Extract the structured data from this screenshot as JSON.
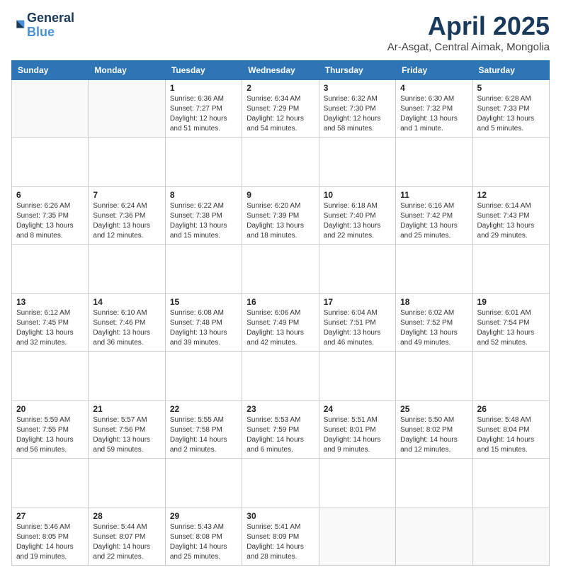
{
  "header": {
    "logo_general": "General",
    "logo_blue": "Blue",
    "month_title": "April 2025",
    "location": "Ar-Asgat, Central Aimak, Mongolia"
  },
  "days_of_week": [
    "Sunday",
    "Monday",
    "Tuesday",
    "Wednesday",
    "Thursday",
    "Friday",
    "Saturday"
  ],
  "weeks": [
    [
      {
        "day": "",
        "info": ""
      },
      {
        "day": "",
        "info": ""
      },
      {
        "day": "1",
        "info": "Sunrise: 6:36 AM\nSunset: 7:27 PM\nDaylight: 12 hours and 51 minutes."
      },
      {
        "day": "2",
        "info": "Sunrise: 6:34 AM\nSunset: 7:29 PM\nDaylight: 12 hours and 54 minutes."
      },
      {
        "day": "3",
        "info": "Sunrise: 6:32 AM\nSunset: 7:30 PM\nDaylight: 12 hours and 58 minutes."
      },
      {
        "day": "4",
        "info": "Sunrise: 6:30 AM\nSunset: 7:32 PM\nDaylight: 13 hours and 1 minute."
      },
      {
        "day": "5",
        "info": "Sunrise: 6:28 AM\nSunset: 7:33 PM\nDaylight: 13 hours and 5 minutes."
      }
    ],
    [
      {
        "day": "6",
        "info": "Sunrise: 6:26 AM\nSunset: 7:35 PM\nDaylight: 13 hours and 8 minutes."
      },
      {
        "day": "7",
        "info": "Sunrise: 6:24 AM\nSunset: 7:36 PM\nDaylight: 13 hours and 12 minutes."
      },
      {
        "day": "8",
        "info": "Sunrise: 6:22 AM\nSunset: 7:38 PM\nDaylight: 13 hours and 15 minutes."
      },
      {
        "day": "9",
        "info": "Sunrise: 6:20 AM\nSunset: 7:39 PM\nDaylight: 13 hours and 18 minutes."
      },
      {
        "day": "10",
        "info": "Sunrise: 6:18 AM\nSunset: 7:40 PM\nDaylight: 13 hours and 22 minutes."
      },
      {
        "day": "11",
        "info": "Sunrise: 6:16 AM\nSunset: 7:42 PM\nDaylight: 13 hours and 25 minutes."
      },
      {
        "day": "12",
        "info": "Sunrise: 6:14 AM\nSunset: 7:43 PM\nDaylight: 13 hours and 29 minutes."
      }
    ],
    [
      {
        "day": "13",
        "info": "Sunrise: 6:12 AM\nSunset: 7:45 PM\nDaylight: 13 hours and 32 minutes."
      },
      {
        "day": "14",
        "info": "Sunrise: 6:10 AM\nSunset: 7:46 PM\nDaylight: 13 hours and 36 minutes."
      },
      {
        "day": "15",
        "info": "Sunrise: 6:08 AM\nSunset: 7:48 PM\nDaylight: 13 hours and 39 minutes."
      },
      {
        "day": "16",
        "info": "Sunrise: 6:06 AM\nSunset: 7:49 PM\nDaylight: 13 hours and 42 minutes."
      },
      {
        "day": "17",
        "info": "Sunrise: 6:04 AM\nSunset: 7:51 PM\nDaylight: 13 hours and 46 minutes."
      },
      {
        "day": "18",
        "info": "Sunrise: 6:02 AM\nSunset: 7:52 PM\nDaylight: 13 hours and 49 minutes."
      },
      {
        "day": "19",
        "info": "Sunrise: 6:01 AM\nSunset: 7:54 PM\nDaylight: 13 hours and 52 minutes."
      }
    ],
    [
      {
        "day": "20",
        "info": "Sunrise: 5:59 AM\nSunset: 7:55 PM\nDaylight: 13 hours and 56 minutes."
      },
      {
        "day": "21",
        "info": "Sunrise: 5:57 AM\nSunset: 7:56 PM\nDaylight: 13 hours and 59 minutes."
      },
      {
        "day": "22",
        "info": "Sunrise: 5:55 AM\nSunset: 7:58 PM\nDaylight: 14 hours and 2 minutes."
      },
      {
        "day": "23",
        "info": "Sunrise: 5:53 AM\nSunset: 7:59 PM\nDaylight: 14 hours and 6 minutes."
      },
      {
        "day": "24",
        "info": "Sunrise: 5:51 AM\nSunset: 8:01 PM\nDaylight: 14 hours and 9 minutes."
      },
      {
        "day": "25",
        "info": "Sunrise: 5:50 AM\nSunset: 8:02 PM\nDaylight: 14 hours and 12 minutes."
      },
      {
        "day": "26",
        "info": "Sunrise: 5:48 AM\nSunset: 8:04 PM\nDaylight: 14 hours and 15 minutes."
      }
    ],
    [
      {
        "day": "27",
        "info": "Sunrise: 5:46 AM\nSunset: 8:05 PM\nDaylight: 14 hours and 19 minutes."
      },
      {
        "day": "28",
        "info": "Sunrise: 5:44 AM\nSunset: 8:07 PM\nDaylight: 14 hours and 22 minutes."
      },
      {
        "day": "29",
        "info": "Sunrise: 5:43 AM\nSunset: 8:08 PM\nDaylight: 14 hours and 25 minutes."
      },
      {
        "day": "30",
        "info": "Sunrise: 5:41 AM\nSunset: 8:09 PM\nDaylight: 14 hours and 28 minutes."
      },
      {
        "day": "",
        "info": ""
      },
      {
        "day": "",
        "info": ""
      },
      {
        "day": "",
        "info": ""
      }
    ]
  ]
}
